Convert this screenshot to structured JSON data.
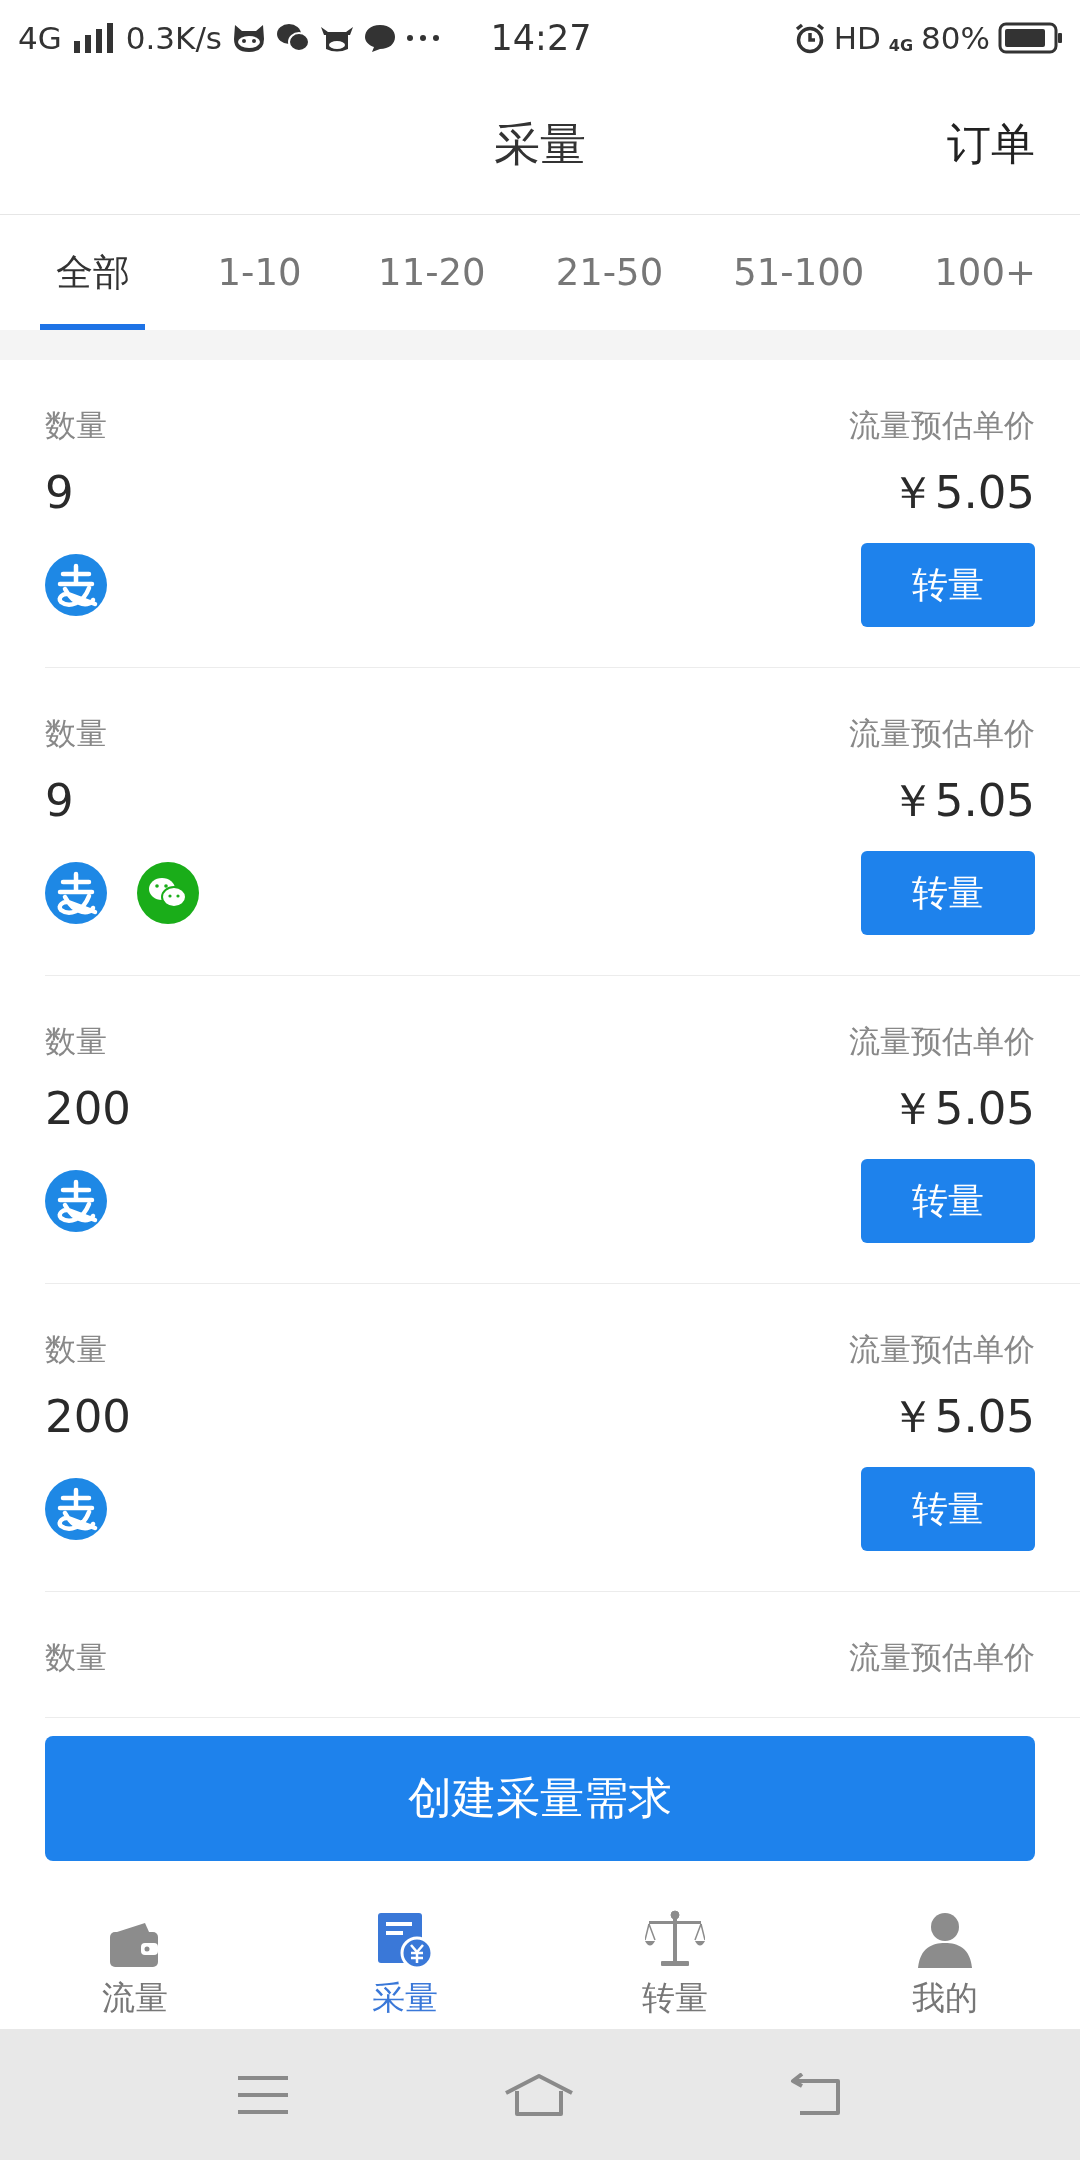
{
  "status_bar": {
    "network": "4G",
    "speed": "0.3K/s",
    "time": "14:27",
    "hd": "HD",
    "network_right": "4G",
    "battery": "80%"
  },
  "header": {
    "title": "采量",
    "action": "订单"
  },
  "tabs": [
    {
      "label": "全部",
      "selected": true
    },
    {
      "label": "1-10",
      "selected": false
    },
    {
      "label": "11-20",
      "selected": false
    },
    {
      "label": "21-50",
      "selected": false
    },
    {
      "label": "51-100",
      "selected": false
    },
    {
      "label": "100+",
      "selected": false
    }
  ],
  "listings": [
    {
      "quantity_label": "数量",
      "quantity": "9",
      "price_label": "流量预估单价",
      "price": "￥5.05",
      "payments": [
        {
          "kind": "alipay"
        }
      ],
      "button": "转量"
    },
    {
      "quantity_label": "数量",
      "quantity": "9",
      "price_label": "流量预估单价",
      "price": "￥5.05",
      "payments": [
        {
          "kind": "alipay"
        },
        {
          "kind": "wechat"
        }
      ],
      "button": "转量"
    },
    {
      "quantity_label": "数量",
      "quantity": "200",
      "price_label": "流量预估单价",
      "price": "￥5.05",
      "payments": [
        {
          "kind": "alipay"
        }
      ],
      "button": "转量"
    },
    {
      "quantity_label": "数量",
      "quantity": "200",
      "price_label": "流量预估单价",
      "price": "￥5.05",
      "payments": [
        {
          "kind": "alipay"
        }
      ],
      "button": "转量"
    },
    {
      "quantity_label": "数量",
      "price_label": "流量预估单价"
    }
  ],
  "create_button": "创建采量需求",
  "bottom_nav": [
    {
      "label": "流量",
      "kind": "wallet",
      "selected": false
    },
    {
      "label": "采量",
      "kind": "document",
      "selected": true
    },
    {
      "label": "转量",
      "kind": "scale",
      "selected": false
    },
    {
      "label": "我的",
      "kind": "person",
      "selected": false
    }
  ]
}
